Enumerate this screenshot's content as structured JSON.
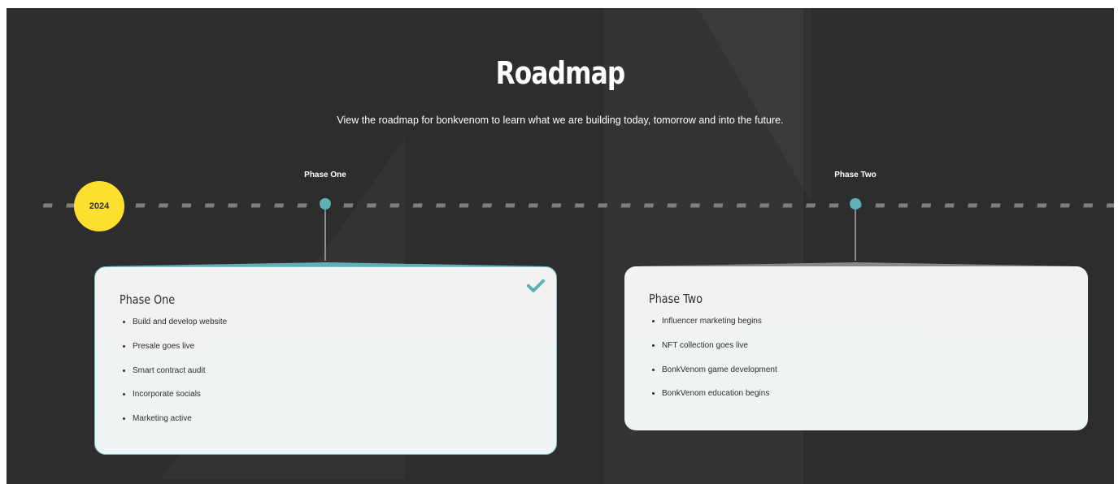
{
  "header": {
    "title": "Roadmap",
    "subtitle": "View the roadmap for bonkvenom to learn what we are building today, tomorrow and into the future."
  },
  "timeline": {
    "year": "2024",
    "markers": [
      {
        "label": "Phase One"
      },
      {
        "label": "Phase Two"
      }
    ]
  },
  "phases": [
    {
      "title": "Phase One",
      "completed": true,
      "status_icon": "checkmark-icon",
      "items": [
        "Build and develop website",
        "Presale goes live",
        "Smart contract audit",
        "Incorporate socials",
        "Marketing active"
      ]
    },
    {
      "title": "Phase Two",
      "completed": false,
      "items": [
        "Influencer marketing begins",
        "NFT collection goes live",
        "BonkVenom game development",
        "BonkVenom education begins"
      ]
    }
  ],
  "colors": {
    "background": "#2e2d2e",
    "accent_teal": "#5fb0b8",
    "year_badge": "#ffe02e",
    "card": "#f2f2f2"
  }
}
